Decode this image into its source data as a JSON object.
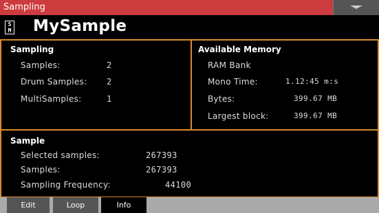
{
  "window": {
    "title": "Sampling"
  },
  "header": {
    "icon_text_top": "S",
    "icon_text_bottom": "M",
    "title": "MySample"
  },
  "sampling": {
    "title": "Sampling",
    "rows": [
      {
        "label": "Samples:",
        "value": "2"
      },
      {
        "label": "Drum Samples:",
        "value": "2"
      },
      {
        "label": "MultiSamples:",
        "value": "1"
      }
    ]
  },
  "memory": {
    "title": "Available Memory",
    "bank": "RAM Bank",
    "rows": [
      {
        "label": "Mono Time:",
        "value": "1.12:45 m:s"
      },
      {
        "label": "Bytes:",
        "value": "399.67 MB"
      },
      {
        "label": "Largest block:",
        "value": "399.67 MB"
      }
    ]
  },
  "sample": {
    "title": "Sample",
    "rows": [
      {
        "label": "Selected samples:",
        "value": "267393"
      },
      {
        "label": "Samples:",
        "value": "267393"
      },
      {
        "label": "Sampling Frequency:",
        "value": "44100"
      }
    ]
  },
  "tabs": [
    {
      "label": "Edit"
    },
    {
      "label": "Loop"
    },
    {
      "label": "Info"
    }
  ],
  "colors": {
    "title_bar": "#cc3b3d",
    "frame": "#d98c2e",
    "tab_bar": "#aaaaaa",
    "active_tab": "#000000",
    "inactive_tab": "#555555"
  }
}
